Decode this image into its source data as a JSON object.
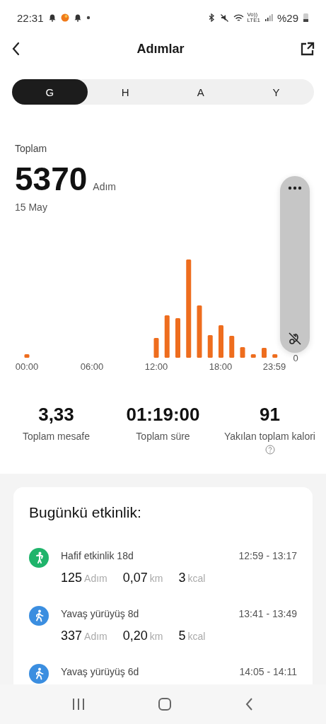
{
  "status_bar": {
    "time": "22:31",
    "volte": "Vo))",
    "network": "LTE1",
    "battery": "%29"
  },
  "header": {
    "title": "Adımlar"
  },
  "tabs": [
    {
      "label": "G",
      "selected": true
    },
    {
      "label": "H",
      "selected": false
    },
    {
      "label": "A",
      "selected": false
    },
    {
      "label": "Y",
      "selected": false
    }
  ],
  "summary": {
    "label": "Toplam",
    "value": "5370",
    "unit": "Adım",
    "date": "15 May"
  },
  "chart": {
    "x_labels": [
      "00:00",
      "06:00",
      "12:00",
      "18:00",
      "23:59"
    ],
    "y_labels": [
      "0"
    ]
  },
  "stats": [
    {
      "value": "3,33",
      "label": "Toplam mesafe",
      "help": false
    },
    {
      "value": "01:19:00",
      "label": "Toplam süre",
      "help": false
    },
    {
      "value": "91",
      "label": "Yakılan toplam kalori",
      "help": true
    }
  ],
  "activity": {
    "title": "Bugünkü etkinlik:",
    "items": [
      {
        "kind": "light",
        "name": "Hafif etkinlik 18d",
        "time": "12:59 - 13:17",
        "steps": "125",
        "steps_unit": "Adım",
        "distance": "0,07",
        "distance_unit": "km",
        "calories": "3",
        "calories_unit": "kcal"
      },
      {
        "kind": "walk",
        "name": "Yavaş yürüyüş 8d",
        "time": "13:41 - 13:49",
        "steps": "337",
        "steps_unit": "Adım",
        "distance": "0,20",
        "distance_unit": "km",
        "calories": "5",
        "calories_unit": "kcal"
      },
      {
        "kind": "walk",
        "name": "Yavaş yürüyüş 6d",
        "time": "14:05 - 14:11"
      }
    ]
  }
}
